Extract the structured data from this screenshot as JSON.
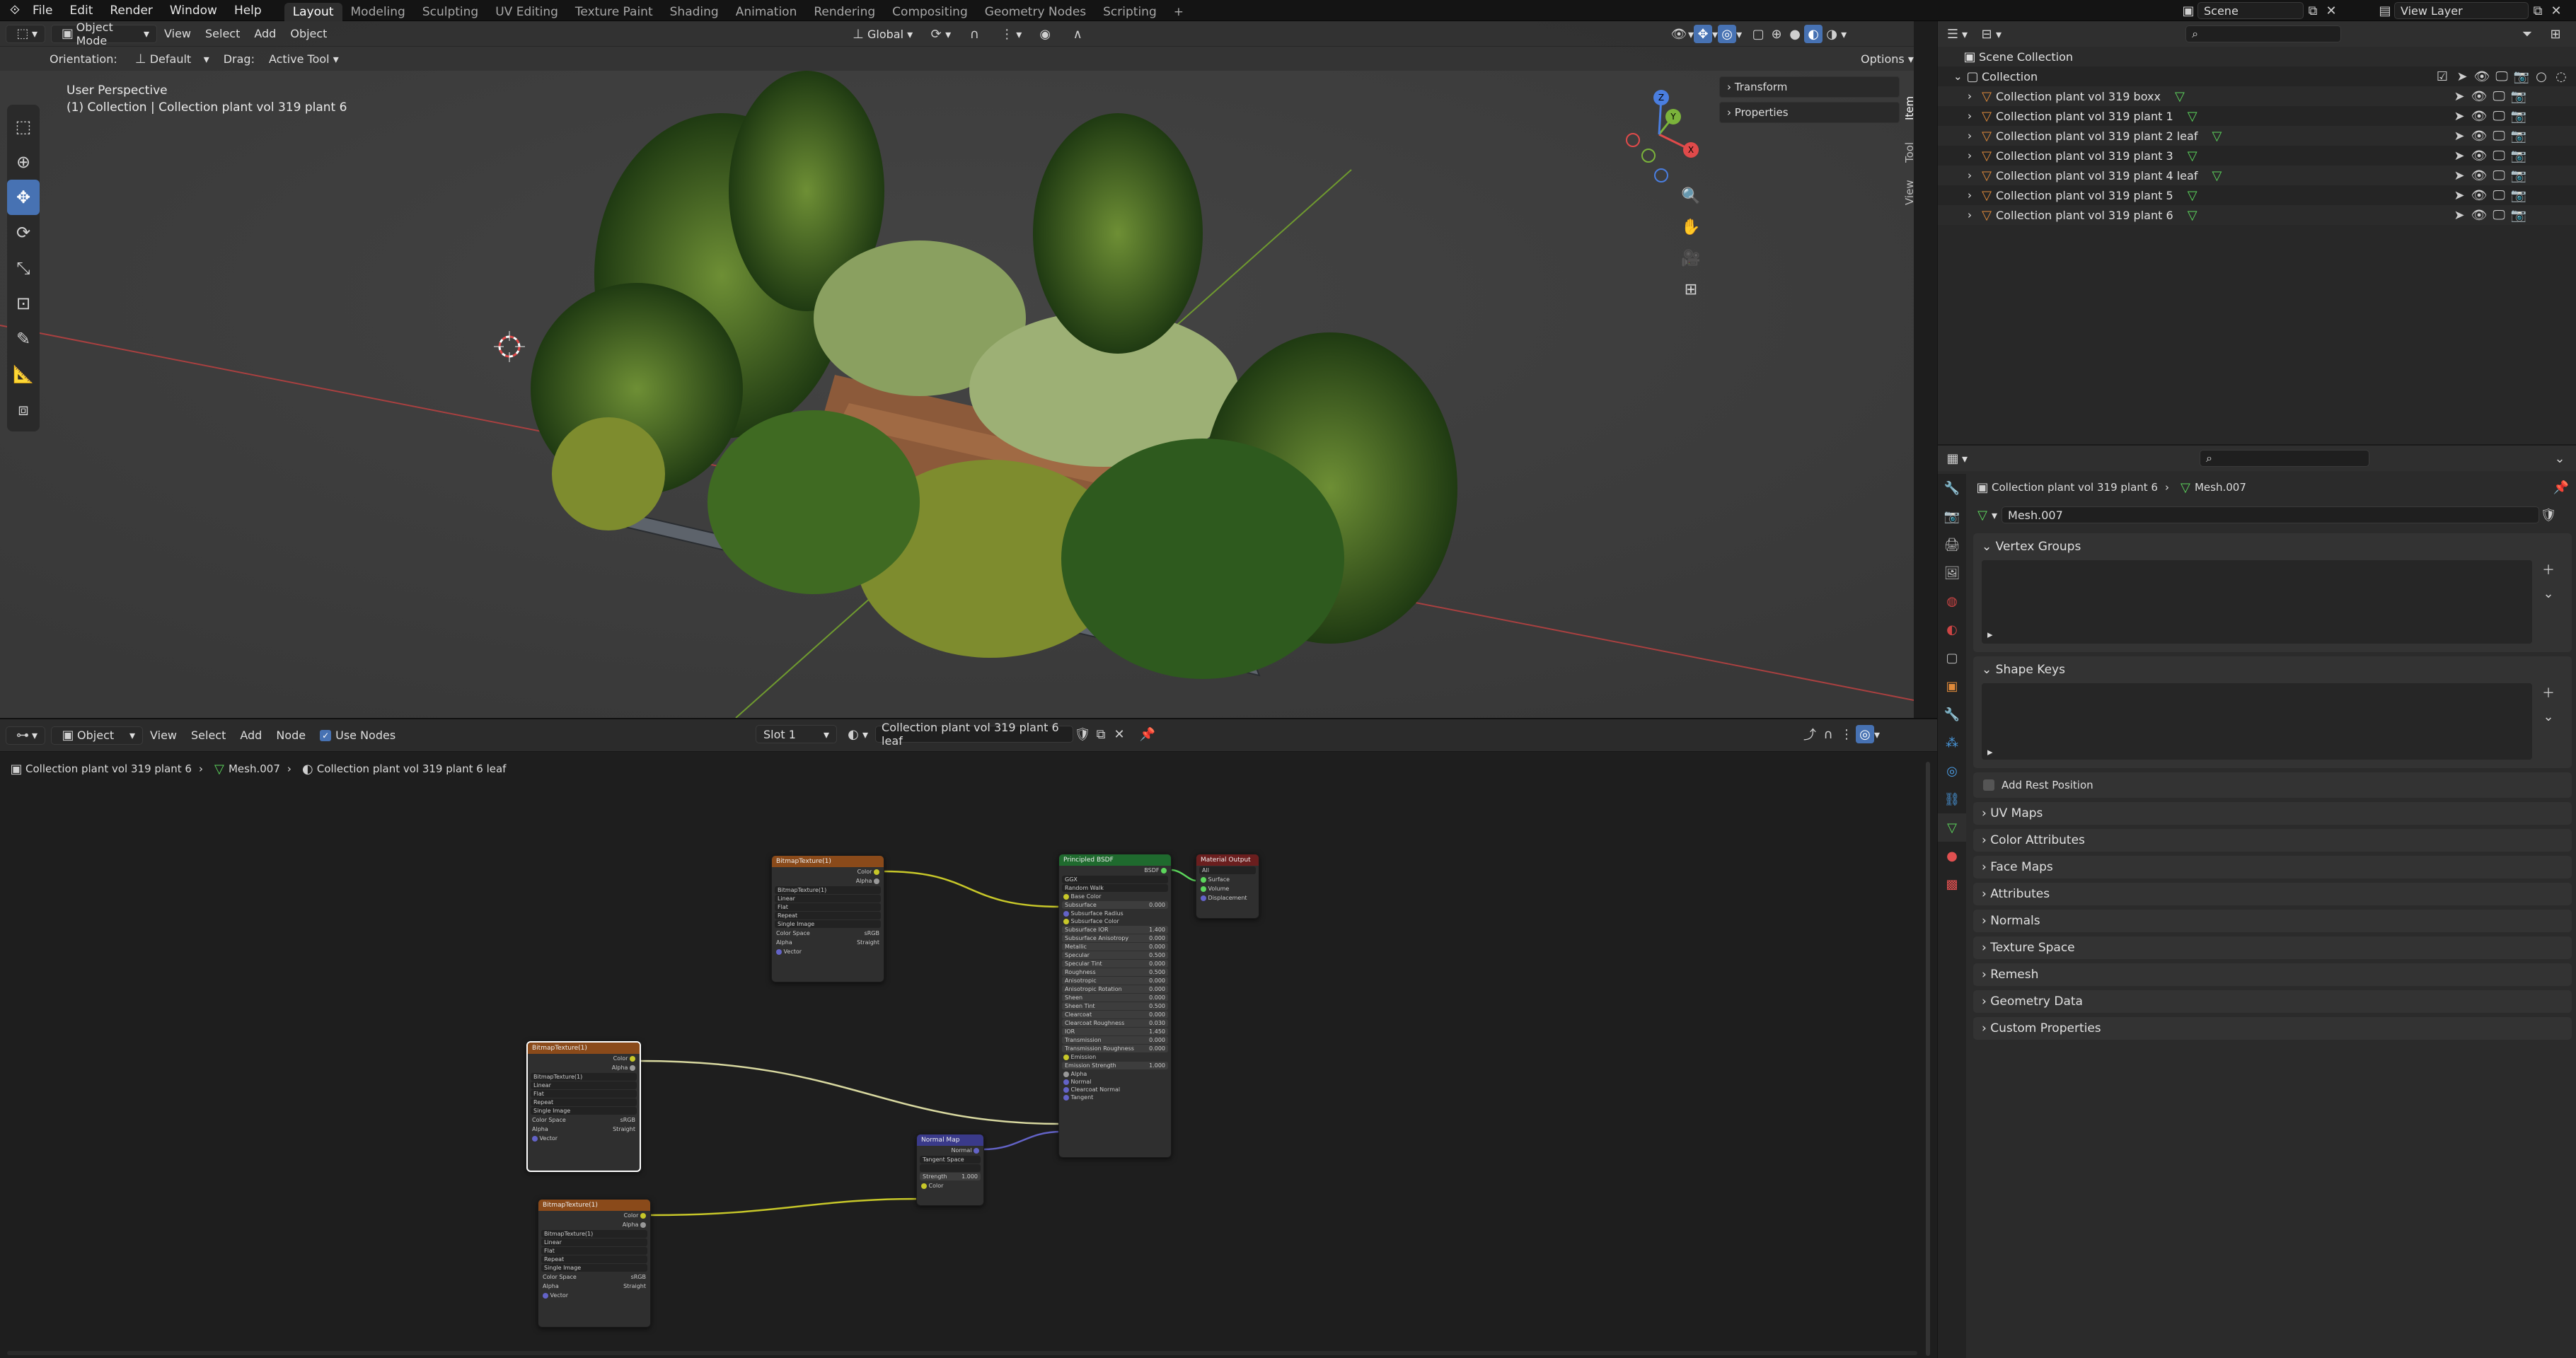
{
  "topbar": {
    "menus": [
      "File",
      "Edit",
      "Render",
      "Window",
      "Help"
    ],
    "workspaces": [
      "Layout",
      "Modeling",
      "Sculpting",
      "UV Editing",
      "Texture Paint",
      "Shading",
      "Animation",
      "Rendering",
      "Compositing",
      "Geometry Nodes",
      "Scripting"
    ],
    "active_workspace": "Layout",
    "add_tab": "+",
    "scene": "Scene",
    "view_layer": "View Layer"
  },
  "viewport": {
    "mode": "Object Mode",
    "menus": [
      "View",
      "Select",
      "Add",
      "Object"
    ],
    "orientation_label": "Orientation:",
    "orientation_value": "Default",
    "drag_label": "Drag:",
    "drag_value": "Active Tool",
    "transform_space": "Global",
    "options": "Options",
    "perspective": "User Perspective",
    "object_info": "(1) Collection | Collection plant vol 319 plant 6",
    "n_panel": [
      "Transform",
      "Properties"
    ],
    "side_tabs": [
      "Item",
      "Tool",
      "View"
    ],
    "gizmo_axes": [
      "X",
      "Y",
      "Z"
    ]
  },
  "outliner": {
    "search_placeholder": "",
    "root": "Scene Collection",
    "collection": "Collection",
    "items": [
      {
        "name": "Collection plant vol 319 boxx"
      },
      {
        "name": "Collection plant vol 319 plant 1"
      },
      {
        "name": "Collection plant vol 319 plant 2 leaf"
      },
      {
        "name": "Collection plant vol 319 plant 3"
      },
      {
        "name": "Collection plant vol 319 plant 4 leaf"
      },
      {
        "name": "Collection plant vol 319 plant 5"
      },
      {
        "name": "Collection plant vol 319 plant 6"
      }
    ]
  },
  "properties": {
    "breadcrumb_object": "Collection plant vol 319 plant 6",
    "breadcrumb_mesh": "Mesh.007",
    "mesh_name": "Mesh.007",
    "vertex_groups": "Vertex Groups",
    "shape_keys": "Shape Keys",
    "add_rest_position": "Add Rest Position",
    "collapsed_panels": [
      "UV Maps",
      "Color Attributes",
      "Face Maps",
      "Attributes",
      "Normals",
      "Texture Space",
      "Remesh",
      "Geometry Data",
      "Custom Properties"
    ]
  },
  "node_editor": {
    "editor_type": "Object",
    "menus": [
      "View",
      "Select",
      "Add",
      "Node"
    ],
    "use_nodes": "Use Nodes",
    "slot": "Slot 1",
    "material": "Collection plant vol 319 plant 6 leaf",
    "breadcrumb_object": "Collection plant vol 319 plant 6",
    "breadcrumb_mesh": "Mesh.007",
    "breadcrumb_material": "Collection plant vol 319 plant 6 leaf",
    "image_node_title": "BitmapTexture(1)",
    "image_node_rows": [
      "Linear",
      "Flat",
      "Repeat",
      "Single Image"
    ],
    "color_space_label": "Color Space",
    "color_space_value": "sRGB",
    "alpha_label": "Alpha",
    "alpha_value": "Straight",
    "vector_label": "Vector",
    "out_color": "Color",
    "out_alpha": "Alpha",
    "bsdf_title": "Principled BSDF",
    "bsdf_out": "BSDF",
    "bsdf_dropdowns": [
      "GGX",
      "Random Walk"
    ],
    "bsdf_rows": [
      {
        "label": "Base Color",
        "value": ""
      },
      {
        "label": "Subsurface",
        "value": "0.000"
      },
      {
        "label": "Subsurface Radius",
        "value": ""
      },
      {
        "label": "Subsurface Color",
        "value": ""
      },
      {
        "label": "Subsurface IOR",
        "value": "1.400"
      },
      {
        "label": "Subsurface Anisotropy",
        "value": "0.000"
      },
      {
        "label": "Metallic",
        "value": "0.000"
      },
      {
        "label": "Specular",
        "value": "0.500"
      },
      {
        "label": "Specular Tint",
        "value": "0.000"
      },
      {
        "label": "Roughness",
        "value": "0.500"
      },
      {
        "label": "Anisotropic",
        "value": "0.000"
      },
      {
        "label": "Anisotropic Rotation",
        "value": "0.000"
      },
      {
        "label": "Sheen",
        "value": "0.000"
      },
      {
        "label": "Sheen Tint",
        "value": "0.500"
      },
      {
        "label": "Clearcoat",
        "value": "0.000"
      },
      {
        "label": "Clearcoat Roughness",
        "value": "0.030"
      },
      {
        "label": "IOR",
        "value": "1.450"
      },
      {
        "label": "Transmission",
        "value": "0.000"
      },
      {
        "label": "Transmission Roughness",
        "value": "0.000"
      },
      {
        "label": "Emission",
        "value": ""
      },
      {
        "label": "Emission Strength",
        "value": "1.000"
      },
      {
        "label": "Alpha",
        "value": ""
      },
      {
        "label": "Normal",
        "value": ""
      },
      {
        "label": "Clearcoat Normal",
        "value": ""
      },
      {
        "label": "Tangent",
        "value": ""
      }
    ],
    "output_title": "Material Output",
    "output_target": "All",
    "output_rows": [
      "Surface",
      "Volume",
      "Displacement"
    ],
    "normalmap_title": "Normal Map",
    "normalmap_out": "Normal",
    "normalmap_space": "Tangent Space",
    "normalmap_strength_label": "Strength",
    "normalmap_strength": "1.000",
    "normalmap_color": "Color"
  },
  "colors": {
    "accent": "#4772b3",
    "image_node_header": "#8a4a1a",
    "shader_node_header": "#1f6a2e",
    "output_node_header": "#6a1e1e",
    "vector_node_header": "#3a3a8a",
    "link_yellow": "#c7c729",
    "link_purple": "#6363c7"
  }
}
